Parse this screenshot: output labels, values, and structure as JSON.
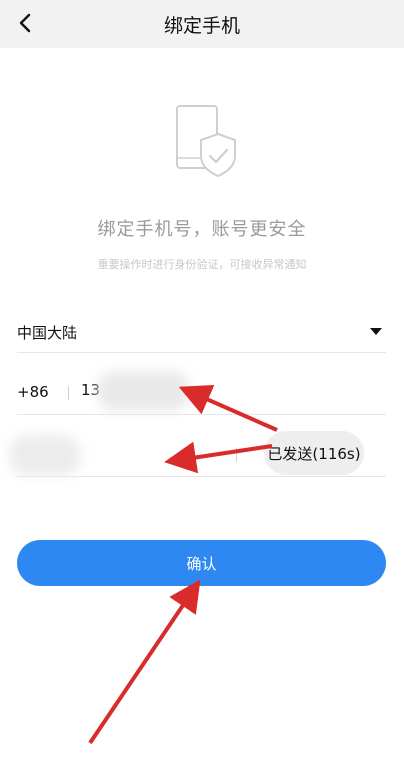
{
  "header": {
    "title": "绑定手机",
    "back_icon": "chevron-left-icon"
  },
  "hero": {
    "icon": "phone-shield-icon",
    "headline": "绑定手机号，账号更安全",
    "subline": "重要操作时进行身份验证，可接收异常通知"
  },
  "region": {
    "label": "中国大陆",
    "icon": "caret-down-icon"
  },
  "phone": {
    "country_code": "+86",
    "value": "13"
  },
  "code": {
    "value": "",
    "send_button_label": "已发送(116s)"
  },
  "confirm": {
    "label": "确认"
  },
  "colors": {
    "primary": "#2e88f1",
    "annotation": "#d92b2b"
  }
}
